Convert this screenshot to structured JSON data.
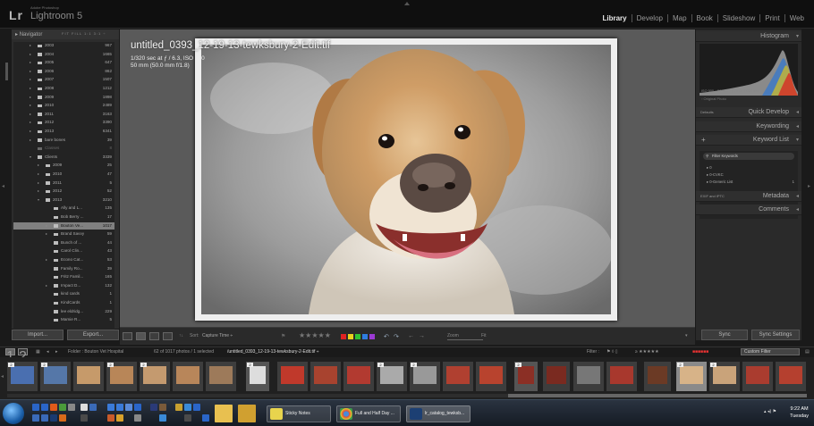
{
  "app": {
    "logo": "Lr",
    "adobe": "Adobe Photoshop",
    "name": "Lightroom 5"
  },
  "modules": [
    {
      "label": "Library",
      "active": true
    },
    {
      "label": "Develop"
    },
    {
      "label": "Map"
    },
    {
      "label": "Book"
    },
    {
      "label": "Slideshow"
    },
    {
      "label": "Print"
    },
    {
      "label": "Web"
    }
  ],
  "navigator": {
    "title": "Navigator",
    "options": "FIT  FILL  1:1  3:1 ÷"
  },
  "folders": [
    {
      "name": "2003",
      "count": "967",
      "level": 1,
      "tri": "▸"
    },
    {
      "name": "2004",
      "count": "1665",
      "level": 1,
      "tri": "▸"
    },
    {
      "name": "2005",
      "count": "647",
      "level": 1,
      "tri": "▸"
    },
    {
      "name": "2006",
      "count": "862",
      "level": 1,
      "tri": "▸"
    },
    {
      "name": "2007",
      "count": "1507",
      "level": 1,
      "tri": "▸"
    },
    {
      "name": "2008",
      "count": "1212",
      "level": 1,
      "tri": "▸"
    },
    {
      "name": "2009",
      "count": "1898",
      "level": 1,
      "tri": "▸"
    },
    {
      "name": "2010",
      "count": "2489",
      "level": 1,
      "tri": "▸"
    },
    {
      "name": "2011",
      "count": "3163",
      "level": 1,
      "tri": "▸"
    },
    {
      "name": "2012",
      "count": "3390",
      "level": 1,
      "tri": "▸"
    },
    {
      "name": "2013",
      "count": "6341",
      "level": 1,
      "tri": "▸"
    },
    {
      "name": "bare bones",
      "count": "39",
      "level": 1,
      "tri": "▸"
    },
    {
      "name": "Classes",
      "count": "8",
      "level": 1,
      "tri": "",
      "dim": true
    },
    {
      "name": "Clients",
      "count": "3339",
      "level": 1,
      "tri": "▾"
    },
    {
      "name": "2009",
      "count": "25",
      "level": 2,
      "tri": "▸"
    },
    {
      "name": "2010",
      "count": "47",
      "level": 2,
      "tri": "▸"
    },
    {
      "name": "2011",
      "count": "5",
      "level": 2,
      "tri": "▸"
    },
    {
      "name": "2012",
      "count": "52",
      "level": 2,
      "tri": "▸"
    },
    {
      "name": "2013",
      "count": "3210",
      "level": 2,
      "tri": "▾"
    },
    {
      "name": "Ally and L...",
      "count": "135",
      "level": 3,
      "tri": ""
    },
    {
      "name": "Bob Berry ...",
      "count": "17",
      "level": 3,
      "tri": ""
    },
    {
      "name": "Bouton Ve...",
      "count": "1017",
      "level": 3,
      "tri": "▸",
      "selected": true
    },
    {
      "name": "Brand Savvy",
      "count": "59",
      "level": 3,
      "tri": "▸"
    },
    {
      "name": "Bunch of ...",
      "count": "44",
      "level": 3,
      "tri": ""
    },
    {
      "name": "Carol Clin...",
      "count": "43",
      "level": 3,
      "tri": ""
    },
    {
      "name": "Econo Cat...",
      "count": "53",
      "level": 3,
      "tri": "▸"
    },
    {
      "name": "Family Ro...",
      "count": "39",
      "level": 3,
      "tri": ""
    },
    {
      "name": "Fritz Famil...",
      "count": "165",
      "level": 3,
      "tri": ""
    },
    {
      "name": "Impact D...",
      "count": "132",
      "level": 3,
      "tri": "▸"
    },
    {
      "name": "kind cards",
      "count": "1",
      "level": 3,
      "tri": ""
    },
    {
      "name": "KindCards",
      "count": "1",
      "level": 3,
      "tri": ""
    },
    {
      "name": "lee eldridg...",
      "count": "229",
      "level": 3,
      "tri": ""
    },
    {
      "name": "Mamie R...",
      "count": "5",
      "level": 3,
      "tri": ""
    }
  ],
  "left_buttons": {
    "import": "Import...",
    "export": "Export..."
  },
  "photo_info": {
    "filename": "untitled_0393_12-19-13-tewksbury-2-Edit.tif",
    "exposure": "1/320 sec at ƒ / 6.3, ISO 500",
    "lens": "50 mm (50.0 mm f/1.8)"
  },
  "toolbar": {
    "sort_label": "Sort:",
    "sort_value": "Capture Time ÷",
    "zoom_label": "Zoom",
    "zoom_value": "Fit",
    "stars": "★★★★★"
  },
  "right_panel": {
    "histogram": "Histogram",
    "hist_info": [
      "ISO 500",
      "50 mm",
      "ƒ / 6.3",
      "1/320 sec"
    ],
    "original_photo": "Original Photo",
    "defaults": "Defaults",
    "quick_develop": "Quick Develop",
    "keywording": "Keywording",
    "keyword_list": "Keyword List",
    "plus": "+",
    "filter_keywords": "Filter Keywords",
    "keywords": [
      {
        "label": "0",
        "count": ""
      },
      {
        "label": "0-CVKC",
        "count": ""
      },
      {
        "label": "0-Generic List",
        "count": "1"
      }
    ],
    "exif": "EXIF and IPTC",
    "metadata": "Metadata",
    "comments": "Comments",
    "sync": "Sync",
    "sync_settings": "Sync Settings"
  },
  "filmstrip_bar": {
    "pages": [
      "1",
      "2"
    ],
    "folder": "Folder : Bouton Vet Hospital",
    "count": "62 of 1017 photos / 1 selected",
    "file": "/untitled_0393_12-19-13-tewksbury-2-Edit.tif ÷",
    "filter": "Filter :",
    "filter_stars": "≥ ★★★★★",
    "custom_filter": "Custom Filter"
  },
  "taskbar": {
    "apps": [
      {
        "label": "Sticky Notes",
        "color": "#e8d44d"
      },
      {
        "label": "Full and Half Day ...",
        "color": "#dd4b39"
      },
      {
        "label": "lr_catalog_tewksb...",
        "color": "#1c3f73"
      }
    ],
    "tray": "▴  ◂)  ⚑",
    "time": "9:22 AM",
    "day": "Tuesday"
  }
}
